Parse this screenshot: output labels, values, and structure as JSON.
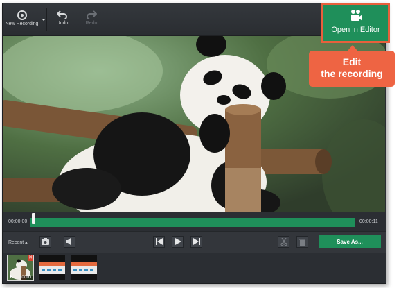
{
  "toolbar": {
    "new_recording_label": "New Recording",
    "undo_label": "Undo",
    "redo_label": "Redo",
    "open_in_editor_label": "Open in Editor"
  },
  "callout": {
    "line1": "Edit",
    "line2": "the recording"
  },
  "timeline": {
    "start_time": "00:00:00",
    "end_time": "00:00:11",
    "progress": 0.0
  },
  "controls": {
    "recent_label": "Recent ▴",
    "save_as_label": "Save As..."
  },
  "thumbnails": [
    {
      "duration": "00:11",
      "selected": true
    },
    {
      "duration": "",
      "selected": false
    },
    {
      "duration": "",
      "selected": false
    }
  ],
  "colors": {
    "accent_green": "#1f8f5a",
    "callout_orange": "#ee6443",
    "window_bg": "#2b2e33"
  }
}
